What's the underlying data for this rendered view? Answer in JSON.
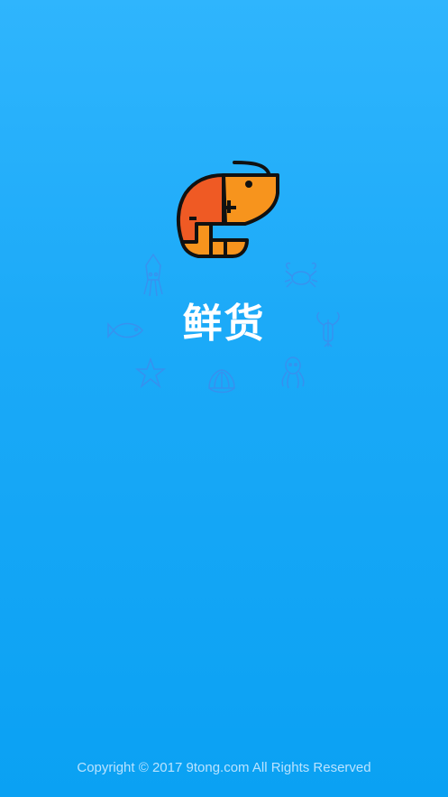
{
  "app": {
    "name": "鲜货"
  },
  "footer": {
    "copyright": "Copyright © 2017  9tong.com All Rights Reserved"
  },
  "icons": {
    "logo": "shrimp-icon",
    "decorations": [
      "squid-icon",
      "crab-icon",
      "fish-icon",
      "lobster-icon",
      "starfish-icon",
      "clam-icon",
      "octopus-icon"
    ]
  },
  "colors": {
    "background_top": "#2fb5fd",
    "background_bottom": "#0aa1f3",
    "logo_orange": "#f7941d",
    "logo_red": "#ef5a24",
    "logo_outline": "#111111",
    "icon_line": "#4d7fe8"
  }
}
